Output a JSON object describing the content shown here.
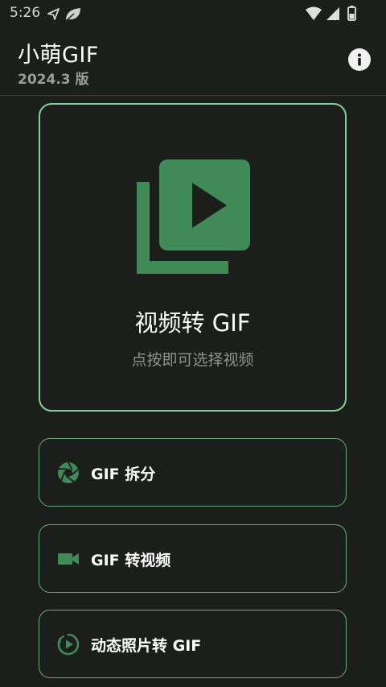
{
  "status_bar": {
    "time": "5:26"
  },
  "header": {
    "title": "小萌GIF",
    "version": "2024.3 版",
    "info_icon": "info-icon"
  },
  "hero": {
    "title": "视频转 GIF",
    "subtitle": "点按即可选择视频",
    "icon": "video-library-icon"
  },
  "actions": [
    {
      "label": "GIF 拆分",
      "icon": "shutter-icon"
    },
    {
      "label": "GIF 转视频",
      "icon": "videocam-icon"
    },
    {
      "label": "动态照片转 GIF",
      "icon": "motion-photo-icon"
    }
  ],
  "colors": {
    "background": "#1c1e1c",
    "accent": "#3f8a57",
    "border": "#7fd197"
  }
}
